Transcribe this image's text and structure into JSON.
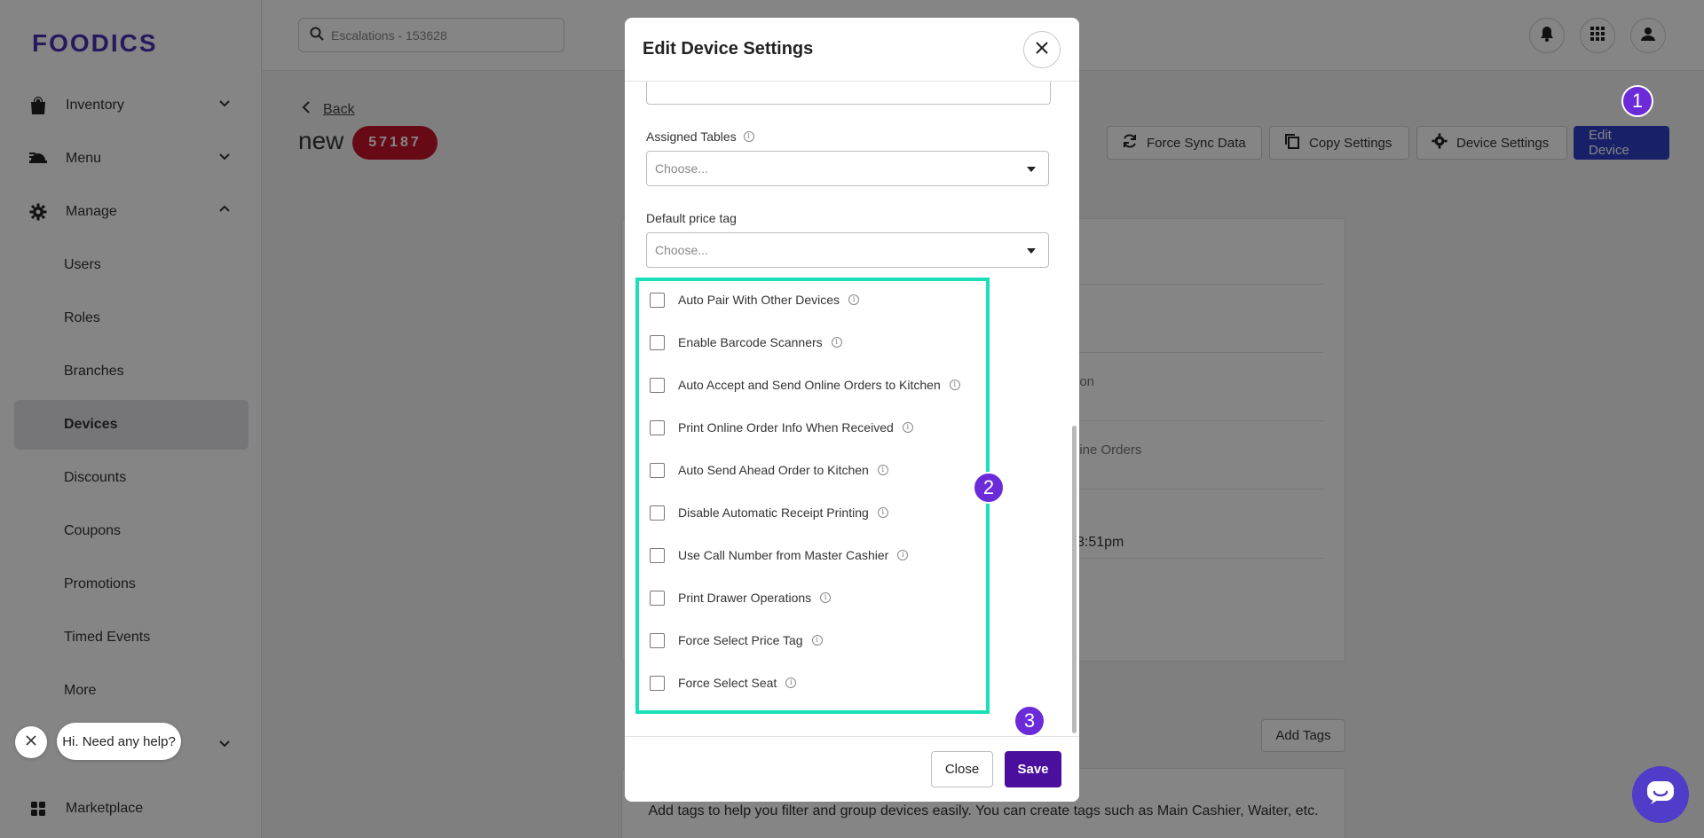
{
  "brand": {
    "logo_text": "FOODICS",
    "logo_color": "#4d2eb3"
  },
  "sidebar": {
    "sections": [
      {
        "label": "Inventory",
        "icon": "bag-icon"
      },
      {
        "label": "Menu",
        "icon": "menu-icon"
      },
      {
        "label": "Manage",
        "icon": "gear-icon"
      }
    ],
    "sub_items": [
      "Users",
      "Roles",
      "Branches",
      "Devices",
      "Discounts",
      "Coupons",
      "Promotions",
      "Timed Events",
      "More"
    ],
    "active_item": "Devices",
    "bottom_item": {
      "label": "Marketplace",
      "icon": "grid-icon"
    }
  },
  "search": {
    "placeholder": "Escalations - 153628"
  },
  "page": {
    "back_label": "Back",
    "title": "new",
    "ref_badge": "57187",
    "actions": [
      "Force Sync Data",
      "Copy Settings",
      "Device Settings",
      "Edit Device"
    ]
  },
  "background_card": {
    "fragment_1": "ion",
    "fragment_2": "line Orders",
    "fragment_3": "3:51pm"
  },
  "tags_section": {
    "add_label": "Add Tags",
    "help_text": "Add tags to help you filter and group devices easily. You can create tags such as Main Cashier, Waiter, etc."
  },
  "modal": {
    "title": "Edit Device Settings",
    "assigned_tables": {
      "label": "Assigned Tables",
      "placeholder": "Choose..."
    },
    "default_price_tag": {
      "label": "Default price tag",
      "placeholder": "Choose..."
    },
    "checkboxes": [
      {
        "label": "Auto Pair With Other Devices",
        "checked": false
      },
      {
        "label": "Enable Barcode Scanners",
        "checked": false
      },
      {
        "label": "Auto Accept and Send Online Orders to Kitchen",
        "checked": false
      },
      {
        "label": "Print Online Order Info When Received",
        "checked": false
      },
      {
        "label": "Auto Send Ahead Order to Kitchen",
        "checked": false
      },
      {
        "label": "Disable Automatic Receipt Printing",
        "checked": false
      },
      {
        "label": "Use Call Number from Master Cashier",
        "checked": false
      },
      {
        "label": "Print Drawer Operations",
        "checked": false
      },
      {
        "label": "Force Select Price Tag",
        "checked": false
      },
      {
        "label": "Force Select Seat",
        "checked": false
      }
    ],
    "close_label": "Close",
    "save_label": "Save"
  },
  "annotations": {
    "markers": [
      "1",
      "2",
      "3"
    ],
    "highlight_color": "#1ae0b8",
    "marker_color": "#6b2bd9"
  },
  "help_chat": {
    "bubble_text": "Hi. Need any help?"
  },
  "colors": {
    "primary_button": "#2f40c8",
    "save_button": "#4b0f9e",
    "badge": "#c5142b"
  }
}
